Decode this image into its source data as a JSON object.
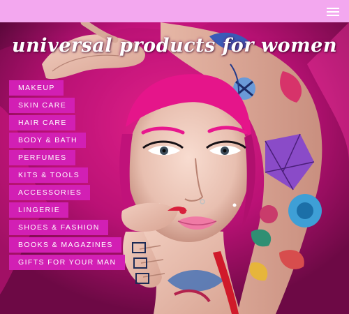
{
  "header": {
    "menu_icon": "hamburger-menu-icon",
    "background_color": "#f3a8ef"
  },
  "hero": {
    "title": "universal products for women",
    "image_subject": "woman-with-pink-hair-and-tattoos"
  },
  "nav": {
    "accent_color": "#d21fb4",
    "items": [
      {
        "label": "MAKEUP"
      },
      {
        "label": "SKIN CARE"
      },
      {
        "label": "HAIR CARE"
      },
      {
        "label": "BODY & BATH"
      },
      {
        "label": "PERFUMES"
      },
      {
        "label": "KITS & TOOLS"
      },
      {
        "label": "ACCESSORIES"
      },
      {
        "label": "LINGERIE"
      },
      {
        "label": "SHOES & FASHION"
      },
      {
        "label": "BOOKS & MAGAZINES"
      },
      {
        "label": "GIFTS FOR YOUR MAN"
      }
    ]
  }
}
